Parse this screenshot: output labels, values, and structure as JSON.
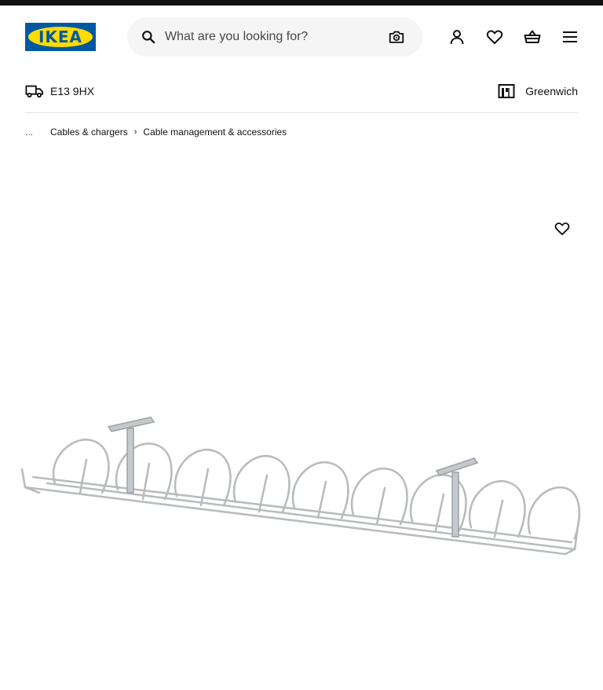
{
  "header": {
    "logo_text": "IKEA",
    "search": {
      "placeholder": "What are you looking for?"
    },
    "icons": [
      "search-icon",
      "camera-icon",
      "account-icon",
      "favourites-icon",
      "basket-icon",
      "menu-icon"
    ]
  },
  "location": {
    "postcode": "E13 9HX",
    "store": "Greenwich"
  },
  "breadcrumb": {
    "ellipsis": "...",
    "items": [
      "Cables & chargers",
      "Cable management & accessories"
    ]
  },
  "colors": {
    "brand_blue": "#0058a3",
    "brand_yellow": "#ffdb00",
    "top_bar": "#111111",
    "search_bg": "#f5f5f5"
  }
}
